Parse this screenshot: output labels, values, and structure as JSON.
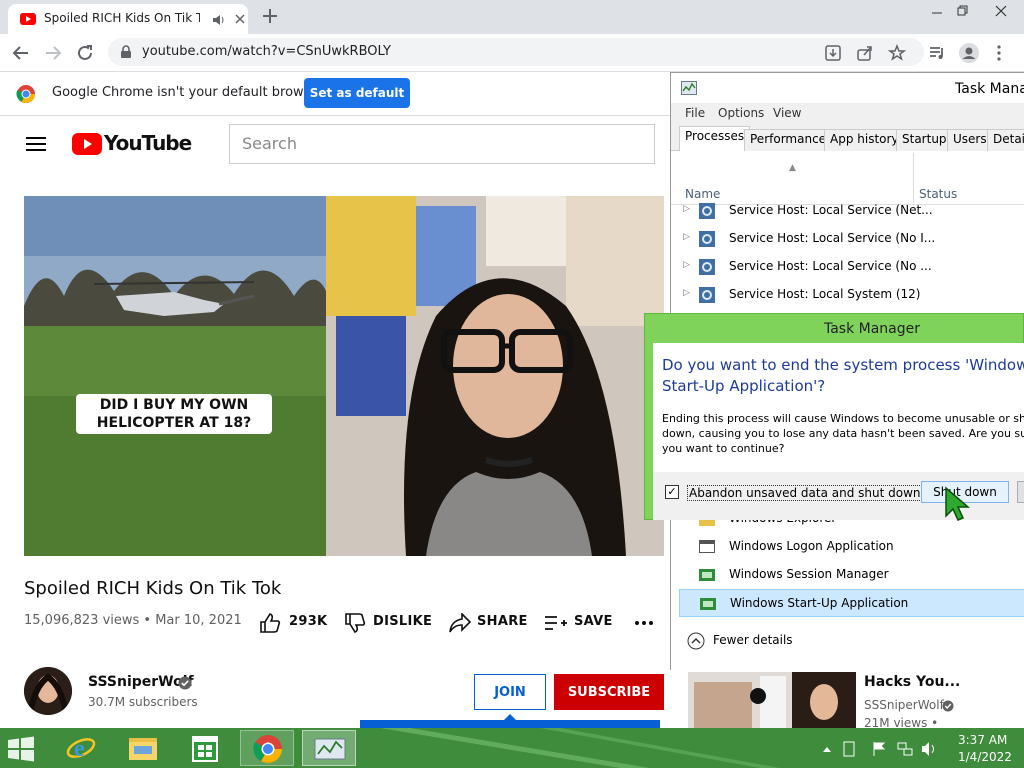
{
  "browser": {
    "tab_title": "Spoiled RICH Kids On Tik Tok",
    "url": "youtube.com/watch?v=CSnUwkRBOLY",
    "infobar_text": "Google Chrome isn't your default browser",
    "set_default_label": "Set as default"
  },
  "youtube": {
    "logo_text": "YouTube",
    "search_placeholder": "Search",
    "video_overlay_caption": "DID I BUY MY OWN HELICOPTER AT 18?",
    "video_title": "Spoiled RICH Kids On Tik Tok",
    "views_date": "15,096,823 views • Mar 10, 2021",
    "likes": "293K",
    "dislike_label": "DISLIKE",
    "share_label": "SHARE",
    "save_label": "SAVE",
    "channel_name": "SSSniperWolf",
    "subscribers": "30.7M subscribers",
    "join_label": "JOIN",
    "subscribe_label": "SUBSCRIBE",
    "related": {
      "title": "Hacks You...",
      "channel": "SSSniperWolf",
      "views": "21M views •"
    }
  },
  "task_manager": {
    "title": "Task Mana",
    "menu": [
      "File",
      "Options",
      "View"
    ],
    "tabs": [
      "Processes",
      "Performance",
      "App history",
      "Startup",
      "Users",
      "Details"
    ],
    "col_name": "Name",
    "col_status": "Status",
    "processes": [
      "Service Host: Local Service (Net...",
      "Service Host: Local Service (No I...",
      "Service Host: Local Service (No ...",
      "Service Host: Local System (12)",
      "Windows Explorer",
      "Windows Logon Application",
      "Windows Session Manager",
      "Windows Start-Up Application"
    ],
    "fewer_details": "Fewer details"
  },
  "dialog": {
    "title": "Task Manager",
    "heading": "Do you want to end the system process 'Windows Start-Up Application'?",
    "body": "Ending this process will cause Windows to become unusable or shut down, causing you to lose any data hasn't been saved. Are you sure you want to continue?",
    "checkbox_label": "Abandon unsaved data and shut down.",
    "shutdown_label": "Shut down"
  },
  "taskbar": {
    "time": "3:37 AM",
    "date": "1/4/2022"
  },
  "colors": {
    "youtube_red": "#ff0000",
    "subscribe_red": "#cc0000",
    "chrome_blue": "#1a73e8",
    "dialog_green": "#7fd35b",
    "taskbar_green": "#3e8c3c"
  }
}
